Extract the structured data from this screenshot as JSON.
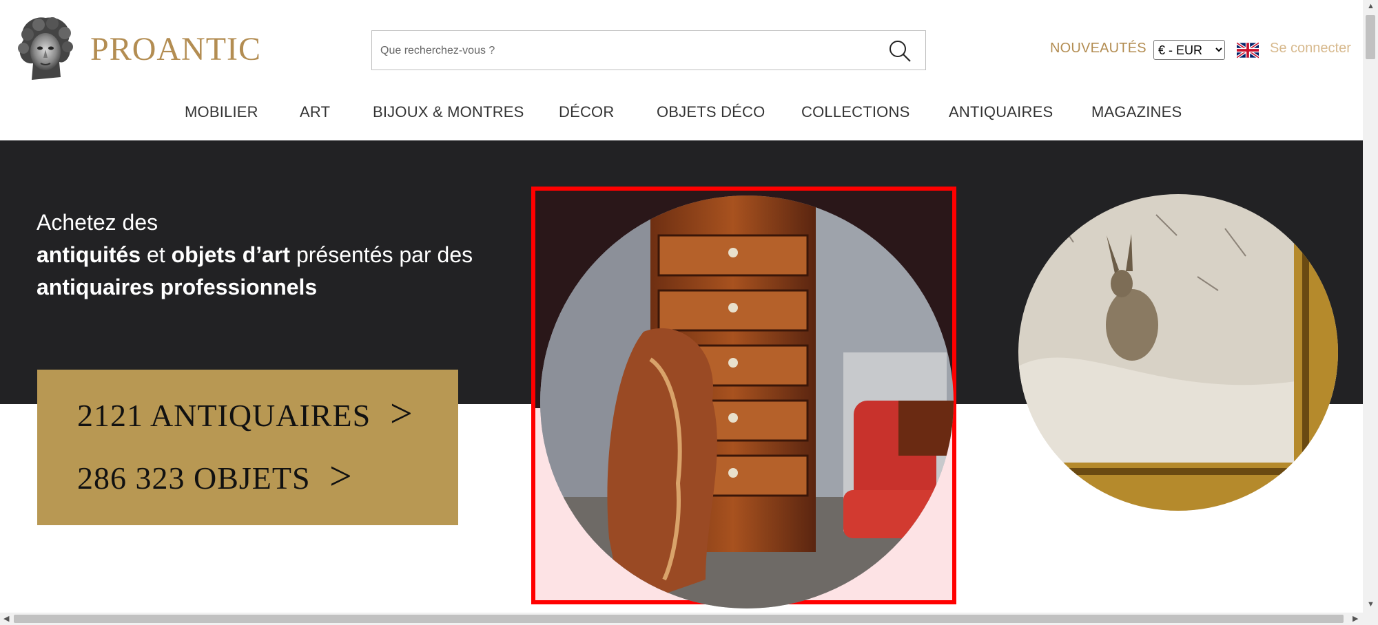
{
  "header": {
    "brand": "PROANTIC",
    "search": {
      "placeholder": "Que recherchez-vous ?"
    },
    "new_label": "NOUVEAUTÉS",
    "currency": {
      "selected": "€ - EUR",
      "options": [
        "€ - EUR"
      ]
    },
    "language_icon": "uk-flag-icon",
    "login_label": "Se connecter"
  },
  "nav": {
    "items": [
      {
        "label": "MOBILIER"
      },
      {
        "label": "ART"
      },
      {
        "label": "BIJOUX & MONTRES"
      },
      {
        "label": "DÉCOR"
      },
      {
        "label": "OBJETS DÉCO"
      },
      {
        "label": "COLLECTIONS"
      },
      {
        "label": "ANTIQUAIRES"
      },
      {
        "label": "MAGAZINES"
      }
    ]
  },
  "hero": {
    "line1": "Achetez des",
    "line2_bold_a": "antiquités",
    "line2_mid": " et ",
    "line2_bold_b": "objets d’art",
    "line2_rest": " présentés par des",
    "line3_bold": "antiquaires professionnels",
    "stats": {
      "dealers": "2121 ANTIQUAIRES",
      "objects": "286 323 OBJETS",
      "chevron": ">"
    }
  },
  "colors": {
    "brand_gold": "#b38d52",
    "stats_box": "#b89853",
    "hero_dark": "#222224",
    "highlight": "#ff0000"
  }
}
